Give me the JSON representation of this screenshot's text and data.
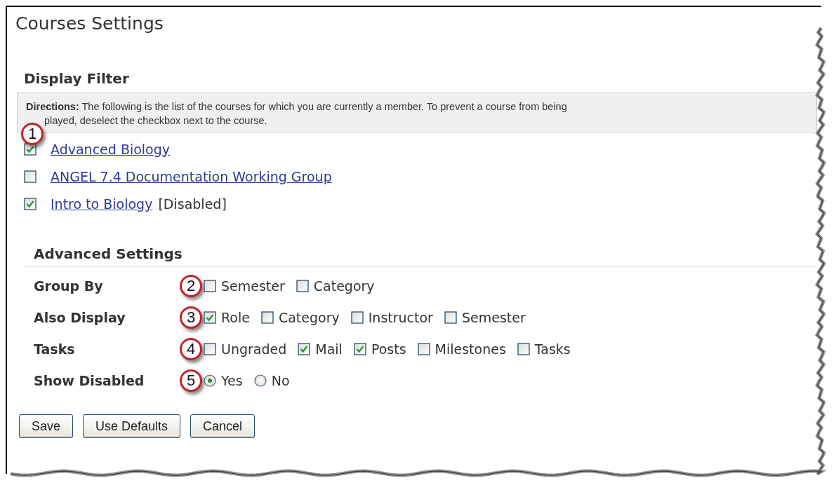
{
  "page": {
    "title": "Courses Settings"
  },
  "display_filter": {
    "heading": "Display Filter",
    "directions": "**Directions:** The following is the list of the courses for which you are currently a member. To prevent a course from being",
    "directions_continued": "played, deselect the checkbox next to the course.",
    "callout": "1",
    "courses": [
      {
        "name": "Advanced Biology",
        "checked": true
      },
      {
        "name": "ANGEL 7.4 Documentation Working Group",
        "checked": false
      },
      {
        "name": "Intro to Biology",
        "checked": true,
        "note": "[Disabled]"
      }
    ]
  },
  "advanced_settings": {
    "heading": "Advanced Settings",
    "rows": [
      {
        "label": "Group By",
        "callout": "2",
        "kind": "checkbox",
        "options": [
          {
            "label": "Semester",
            "checked": false
          },
          {
            "label": "Category",
            "checked": false
          }
        ]
      },
      {
        "label": "Also Display",
        "callout": "3",
        "kind": "checkbox",
        "options": [
          {
            "label": "Role",
            "checked": true
          },
          {
            "label": "Category",
            "checked": false
          },
          {
            "label": "Instructor",
            "checked": false
          },
          {
            "label": "Semester",
            "checked": false
          }
        ]
      },
      {
        "label": "Tasks",
        "callout": "4",
        "kind": "checkbox",
        "options": [
          {
            "label": "Ungraded",
            "checked": false
          },
          {
            "label": "Mail",
            "checked": true
          },
          {
            "label": "Posts",
            "checked": true
          },
          {
            "label": "Milestones",
            "checked": false
          },
          {
            "label": "Tasks",
            "checked": false
          }
        ]
      },
      {
        "label": "Show Disabled",
        "callout": "5",
        "kind": "radio",
        "options": [
          {
            "label": "Yes",
            "selected": true
          },
          {
            "label": "No",
            "selected": false
          }
        ]
      }
    ]
  },
  "buttons": [
    "Save",
    "Use Defaults",
    "Cancel"
  ]
}
